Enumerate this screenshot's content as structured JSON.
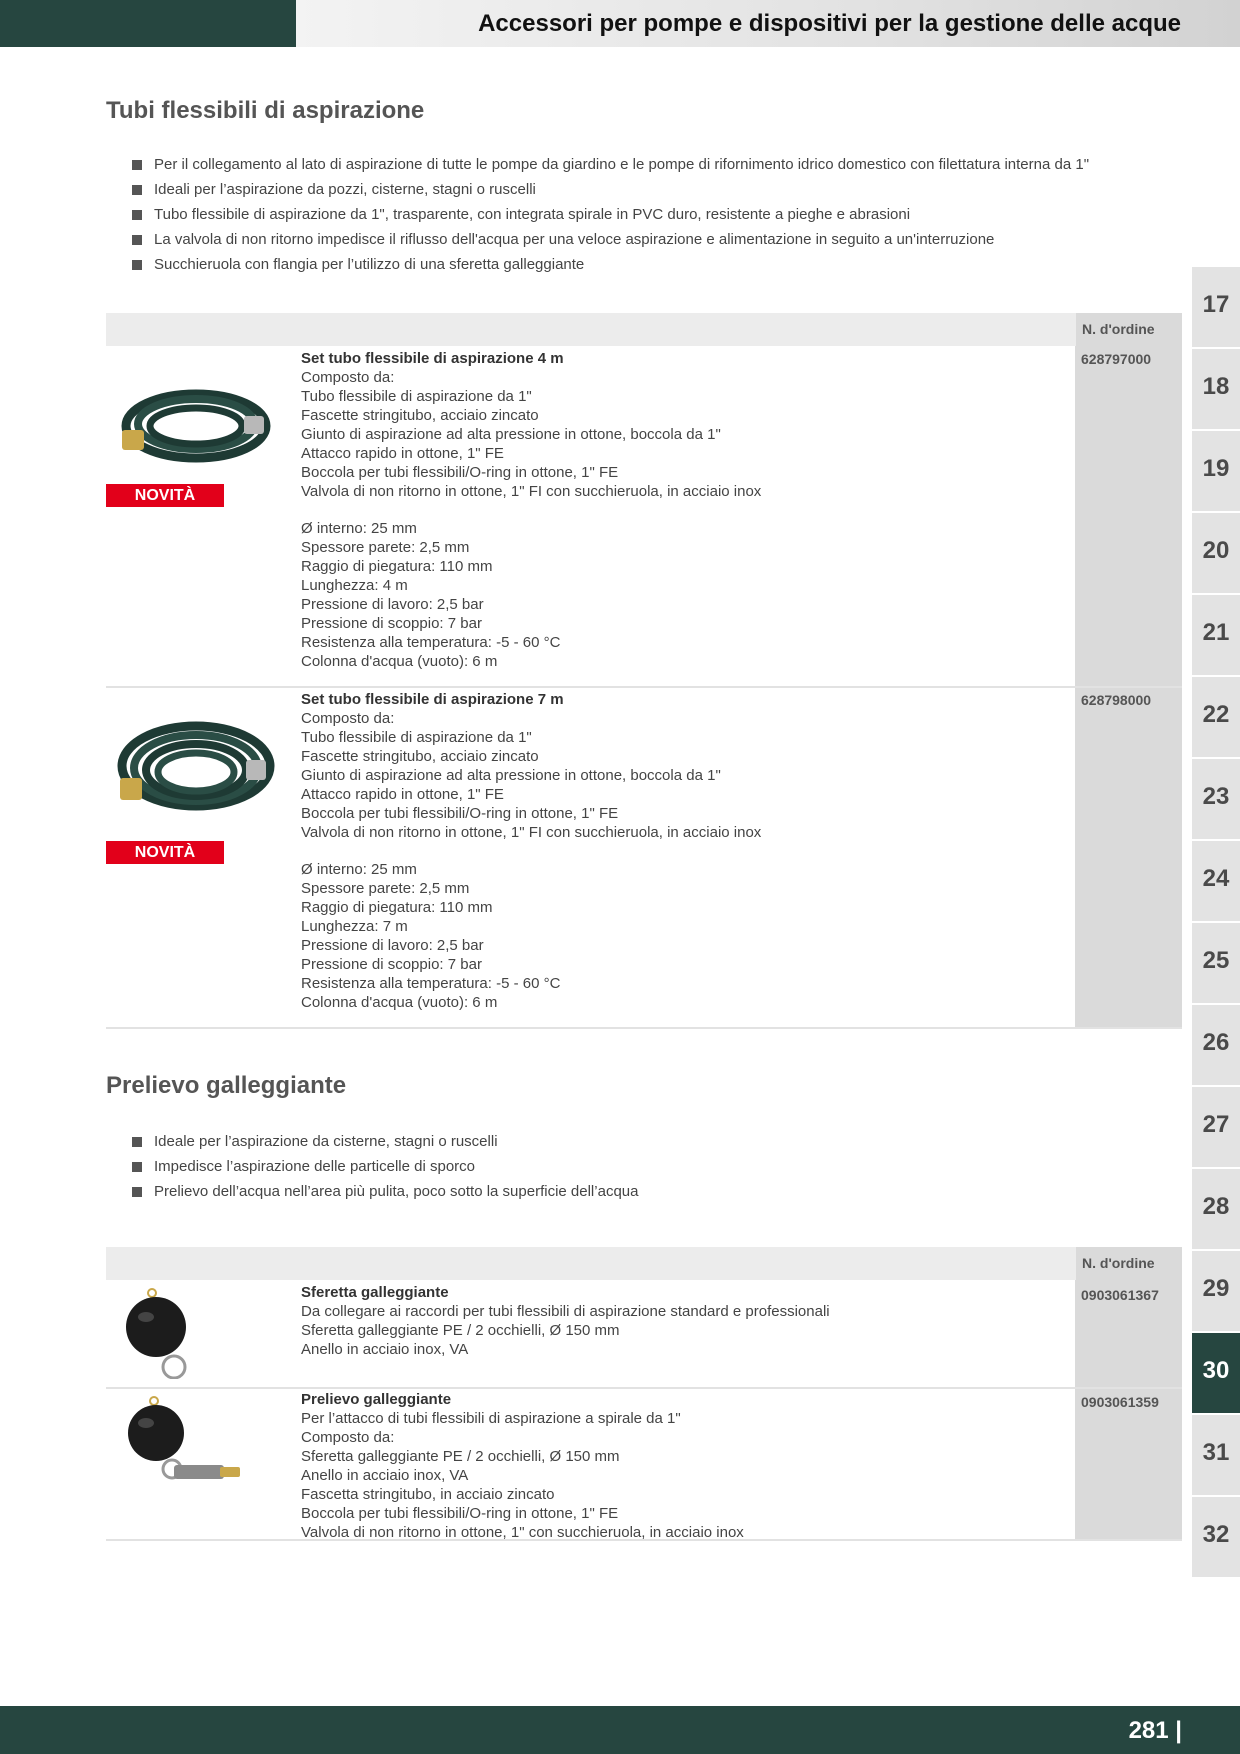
{
  "header": {
    "title": "Accessori per pompe e dispositivi per la gestione delle acque"
  },
  "section1": {
    "title": "Tubi flessibili di aspirazione",
    "bullets": [
      "Per il collegamento al lato di aspirazione di tutte le pompe da giardino e le pompe di rifornimento idrico domestico con filettatura interna da 1\"",
      "Ideali per l’aspirazione da pozzi, cisterne, stagni o ruscelli",
      "Tubo flessibile di aspirazione da 1\", trasparente, con integrata spirale in PVC duro, resistente a pieghe e abrasioni",
      "La valvola di non ritorno impedisce il riflusso dell'acqua per una veloce aspirazione e alimentazione in seguito a un'interruzione",
      "Succhieruola con flangia per l’utilizzo di una sferetta galleggiante"
    ],
    "order_header": "N. d'ordine",
    "products": [
      {
        "name": "Set tubo flessibile di aspirazione 4 m",
        "order": "628797000",
        "badge": "NOVITÀ",
        "lines": [
          "Composto da:",
          "Tubo flessibile di aspirazione da 1\"",
          "Fascette stringitubo, acciaio zincato",
          "Giunto di aspirazione ad alta pressione in ottone, boccola da 1\"",
          "Attacco rapido in ottone, 1\" FE",
          "Boccola per tubi flessibili/O-ring in ottone, 1\" FE",
          "Valvola di non ritorno in ottone, 1\" FI con succhieruola, in acciaio inox"
        ],
        "specs": [
          "Ø interno: 25 mm",
          "Spessore parete: 2,5 mm",
          "Raggio di piegatura: 110 mm",
          "Lunghezza: 4 m",
          "Pressione di lavoro: 2,5 bar",
          "Pressione di scoppio: 7 bar",
          "Resistenza alla temperatura: -5 - 60 °C",
          "Colonna d'acqua (vuoto): 6 m"
        ]
      },
      {
        "name": "Set tubo flessibile di aspirazione 7 m",
        "order": "628798000",
        "badge": "NOVITÀ",
        "lines": [
          "Composto da:",
          "Tubo flessibile di aspirazione da 1\"",
          "Fascette stringitubo, acciaio zincato",
          "Giunto di aspirazione ad alta pressione in ottone, boccola da 1\"",
          "Attacco rapido in ottone, 1\" FE",
          "Boccola per tubi flessibili/O-ring in ottone, 1\" FE",
          "Valvola di non ritorno in ottone, 1\" FI con succhieruola, in acciaio inox"
        ],
        "specs": [
          "Ø interno: 25 mm",
          "Spessore parete: 2,5 mm",
          "Raggio di piegatura: 110 mm",
          "Lunghezza: 7 m",
          "Pressione di lavoro: 2,5 bar",
          "Pressione di scoppio: 7 bar",
          "Resistenza alla temperatura: -5 - 60 °C",
          "Colonna d'acqua (vuoto): 6 m"
        ]
      }
    ]
  },
  "section2": {
    "title": "Prelievo galleggiante",
    "bullets": [
      "Ideale per l’aspirazione da cisterne, stagni o ruscelli",
      "Impedisce l’aspirazione delle particelle di sporco",
      "Prelievo dell’acqua nell’area più pulita, poco sotto la superficie dell’acqua"
    ],
    "order_header": "N. d'ordine",
    "products": [
      {
        "name": "Sferetta galleggiante",
        "order": "0903061367",
        "lines": [
          "Da collegare ai raccordi per tubi flessibili di aspirazione standard e professionali",
          "Sferetta galleggiante PE / 2 occhielli, Ø 150 mm",
          "Anello in acciaio inox, VA"
        ]
      },
      {
        "name": "Prelievo galleggiante",
        "order": "0903061359",
        "lines": [
          "Per l’attacco di tubi flessibili di aspirazione a spirale da 1\"",
          "Composto da:",
          "Sferetta galleggiante PE / 2 occhielli, Ø 150 mm",
          "Anello in acciaio inox, VA",
          "Fascetta stringitubo, in acciaio zincato",
          "Boccola per tubi flessibili/O-ring in ottone, 1\" FE",
          "Valvola di non ritorno in ottone, 1\" con succhieruola, in acciaio inox"
        ]
      }
    ]
  },
  "side_tabs": [
    "17",
    "18",
    "19",
    "20",
    "21",
    "22",
    "23",
    "24",
    "25",
    "26",
    "27",
    "28",
    "29",
    "30",
    "31",
    "32"
  ],
  "active_tab": "30",
  "footer": {
    "page_number": "281 |"
  },
  "colors": {
    "dark_green": "#264640",
    "badge_red": "#e2001a",
    "order_column": "#dadada"
  }
}
